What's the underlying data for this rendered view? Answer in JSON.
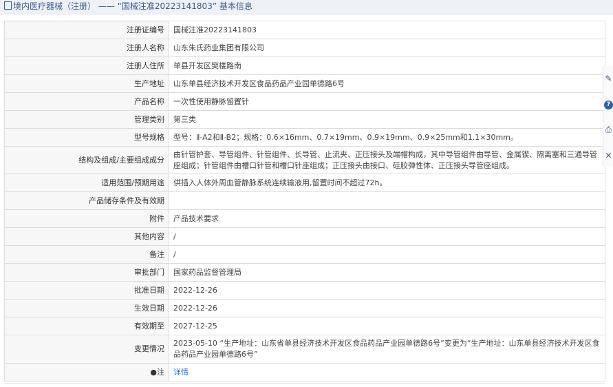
{
  "header": {
    "title": "境内医疗器械（注册） —— “国械注准20223141803” 基本信息"
  },
  "rows": [
    {
      "label": "注册证编号",
      "value": "国械注准20223141803"
    },
    {
      "label": "注册人名称",
      "value": "山东朱氏药业集团有限公司"
    },
    {
      "label": "注册人住所",
      "value": "单县开发区樊楼路南"
    },
    {
      "label": "生产地址",
      "value": "山东单县经济技术开发区食品药品产业园单德路6号"
    },
    {
      "label": "产品名称",
      "value": "一次性使用静脉留置针"
    },
    {
      "label": "管理类别",
      "value": "第三类"
    },
    {
      "label": "型号规格",
      "value": "型号：Ⅱ-A2和Ⅱ-B2；规格：0.6×16mm、0.7×19mm、0.9×19mm、0.9×25mm和1.1×30mm。"
    },
    {
      "label": "结构及组成/主要组成成分",
      "value": "由针管护套、导管组件、针管组件、长导管、止流夹、正压接头及端帽构成，其中导管组件由导管、金属锲、隔离塞和三通导管座组成；针管组件由槽口针管和槽口针座组成；正压接头由接口、硅胶弹性体、正压接头导管座组成。"
    },
    {
      "label": "适用范围/预期用途",
      "value": "供插入人体外周血管静脉系统连续输液用,留置时间不超过72h。"
    },
    {
      "label": "产品储存条件及有效期",
      "value": ""
    },
    {
      "label": "附件",
      "value": "产品技术要求"
    },
    {
      "label": "其他内容",
      "value": "/"
    },
    {
      "label": "备注",
      "value": "/"
    },
    {
      "label": "审批部门",
      "value": "国家药品监督管理局"
    },
    {
      "label": "批准日期",
      "value": "2022-12-26"
    },
    {
      "label": "生效日期",
      "value": "2022-12-26"
    },
    {
      "label": "有效期至",
      "value": "2027-12-25"
    },
    {
      "label": "变更情况",
      "value": "2023-05-10 “生产地址：山东省单县经济技术开发区食品药品产业园单德路6号”变更为“生产地址：山东单县经济技术开发区食品药品产业园单德路6号”"
    },
    {
      "label": "注",
      "value": "详情"
    }
  ],
  "icons": {
    "note_label_icon": "pin-icon",
    "side_tools": [
      "edit-icon",
      "help-icon",
      "print-icon",
      "close-icon"
    ]
  },
  "colors": {
    "link": "#2a6ecf",
    "header_text": "#3a5a8c",
    "header_bg": "#eef1f6",
    "label_bg": "#f7f7f7",
    "border": "#dcdcdc"
  }
}
